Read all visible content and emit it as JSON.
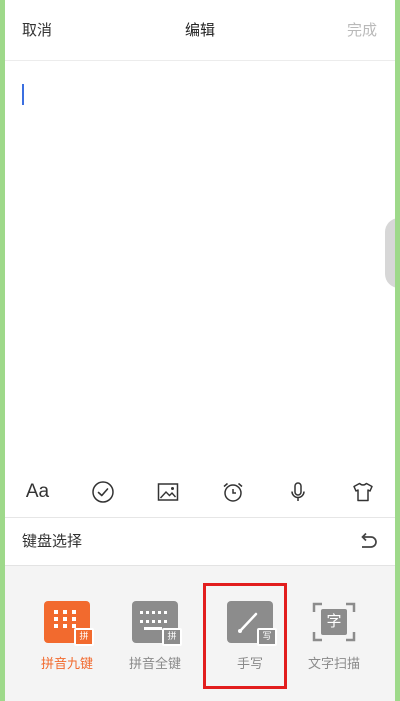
{
  "header": {
    "cancel_label": "取消",
    "title": "编辑",
    "done_label": "完成"
  },
  "toolbar": {
    "items": [
      {
        "name": "font-style",
        "label": "Aa"
      },
      {
        "name": "check-icon"
      },
      {
        "name": "image-icon"
      },
      {
        "name": "alarm-clock-icon"
      },
      {
        "name": "microphone-icon"
      },
      {
        "name": "tshirt-icon"
      }
    ]
  },
  "keyboard_select": {
    "title": "键盘选择",
    "options": [
      {
        "label": "拼音九键",
        "badge": "拼",
        "active": true
      },
      {
        "label": "拼音全键",
        "badge": "拼",
        "active": false
      },
      {
        "label": "手写",
        "badge": "写",
        "active": false,
        "highlighted": true
      },
      {
        "label": "文字扫描",
        "badge": "字",
        "active": false
      }
    ]
  },
  "colors": {
    "accent": "#f26a2e",
    "highlight": "#e21d1d",
    "cursor": "#3b6fe0"
  }
}
